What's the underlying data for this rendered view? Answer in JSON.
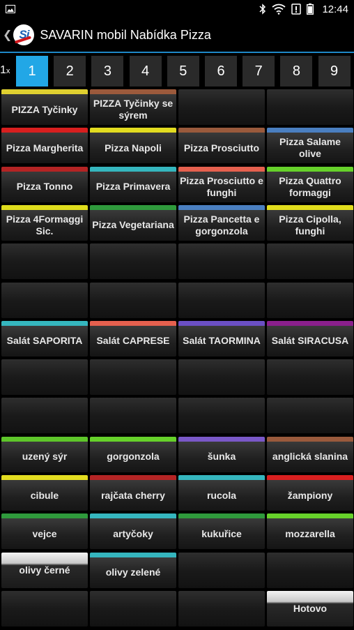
{
  "status_bar": {
    "time": "12:44"
  },
  "app_bar": {
    "title": "SAVARIN mobil Nabídka Pizza",
    "logo_text": "Si"
  },
  "quantity": {
    "value": "1",
    "unit": "x"
  },
  "pages": [
    "1",
    "2",
    "3",
    "4",
    "5",
    "6",
    "7",
    "8",
    "9"
  ],
  "active_page": "1",
  "colors": {
    "accent": "#22a7e6",
    "divider": "#1e88c8"
  },
  "grid_rows": [
    [
      {
        "label": "PIZZA Tyčinky",
        "color": "#e0d030"
      },
      {
        "label": "PIZZA Tyčinky se sýrem",
        "color": "#9c5a3c"
      },
      {
        "label": "",
        "color": ""
      },
      {
        "label": "",
        "color": ""
      }
    ],
    [
      {
        "label": "Pizza Margherita",
        "color": "#d81f1f"
      },
      {
        "label": "Pizza Napoli",
        "color": "#e2dc20"
      },
      {
        "label": "Pizza Prosciutto",
        "color": "#9a5a3c"
      },
      {
        "label": "Pizza Salame olive",
        "color": "#4a7fc0"
      }
    ],
    [
      {
        "label": "Pizza Tonno",
        "color": "#b42424"
      },
      {
        "label": "Pizza Primavera",
        "color": "#35b6be"
      },
      {
        "label": "Pizza Prosciutto e funghi",
        "color": "#e5604e"
      },
      {
        "label": "Pizza Quattro formaggi",
        "color": "#66d12a"
      }
    ],
    [
      {
        "label": "Pizza 4Formaggi Sic.",
        "color": "#dedc1c"
      },
      {
        "label": "Pizza Vegetariana",
        "color": "#2f9a3c"
      },
      {
        "label": "Pizza Pancetta e gorgonzola",
        "color": "#4a7fc0"
      },
      {
        "label": "Pizza Cipolla, funghi",
        "color": "#e0dc1c"
      }
    ],
    [
      {
        "label": "",
        "color": ""
      },
      {
        "label": "",
        "color": ""
      },
      {
        "label": "",
        "color": ""
      },
      {
        "label": "",
        "color": ""
      }
    ],
    [
      {
        "label": "",
        "color": ""
      },
      {
        "label": "",
        "color": ""
      },
      {
        "label": "",
        "color": ""
      },
      {
        "label": "",
        "color": ""
      }
    ],
    [
      {
        "label": "Salát SAPORITA",
        "color": "#35b6be"
      },
      {
        "label": "Salát CAPRESE",
        "color": "#e5604e"
      },
      {
        "label": "Salát TAORMINA",
        "color": "#6b4fc4"
      },
      {
        "label": "Salát SIRACUSA",
        "color": "#8a1f8c"
      }
    ],
    [
      {
        "label": "",
        "color": ""
      },
      {
        "label": "",
        "color": ""
      },
      {
        "label": "",
        "color": ""
      },
      {
        "label": "",
        "color": ""
      }
    ],
    [
      {
        "label": "",
        "color": ""
      },
      {
        "label": "",
        "color": ""
      },
      {
        "label": "",
        "color": ""
      },
      {
        "label": "",
        "color": ""
      }
    ],
    [
      {
        "label": "uzený sýr",
        "color": "#5ec62a"
      },
      {
        "label": "gorgonzola",
        "color": "#66d12a"
      },
      {
        "label": "šunka",
        "color": "#7a58c8"
      },
      {
        "label": "anglická slanina",
        "color": "#9a5a3c"
      }
    ],
    [
      {
        "label": "cibule",
        "color": "#e2dc20"
      },
      {
        "label": "rajčata cherry",
        "color": "#b42424"
      },
      {
        "label": "rucola",
        "color": "#35b6be"
      },
      {
        "label": "žampiony",
        "color": "#d81f1f"
      }
    ],
    [
      {
        "label": "vejce",
        "color": "#2f9a3c"
      },
      {
        "label": "artyčoky",
        "color": "#35b6be"
      },
      {
        "label": "kukuřice",
        "color": "#2f9a3c"
      },
      {
        "label": "mozzarella",
        "color": "#66d12a"
      }
    ],
    [
      {
        "label": "olivy   černé",
        "color": "light"
      },
      {
        "label": "olivy   zelené",
        "color": "#35b6be"
      },
      {
        "label": "",
        "color": ""
      },
      {
        "label": "",
        "color": ""
      }
    ],
    [
      {
        "label": "",
        "color": ""
      },
      {
        "label": "",
        "color": ""
      },
      {
        "label": "",
        "color": ""
      },
      {
        "label": "Hotovo",
        "color": "light"
      }
    ]
  ]
}
